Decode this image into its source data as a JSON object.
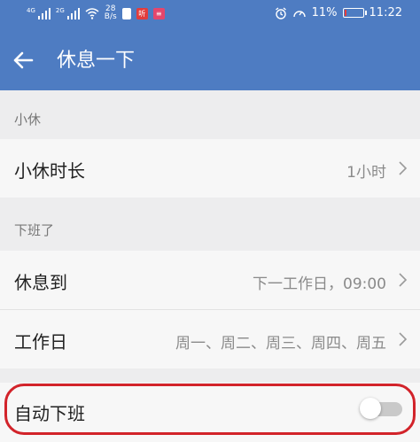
{
  "status_bar": {
    "signal1_label": "4G",
    "signal2_label": "2G",
    "speed_value": "28",
    "speed_unit": "B/s",
    "battery_percent": "11%",
    "time": "11:22",
    "app_badge_1": "听",
    "app_badge_2": "≡",
    "battery_level": 0.11
  },
  "header": {
    "title": "休息一下",
    "back_icon": "arrow-left-icon"
  },
  "sections": {
    "break": {
      "label": "小休",
      "duration_label": "小休时长",
      "duration_value": "1小时"
    },
    "off_work": {
      "label": "下班了",
      "rest_until_label": "休息到",
      "rest_until_value": "下一工作日，09:00",
      "workdays_label": "工作日",
      "workdays_value": "周一、周二、周三、周四、周五"
    },
    "auto_off": {
      "label": "自动下班",
      "enabled": false
    }
  },
  "colors": {
    "header_bg": "#4e7cc2",
    "highlight": "#d2232a"
  }
}
